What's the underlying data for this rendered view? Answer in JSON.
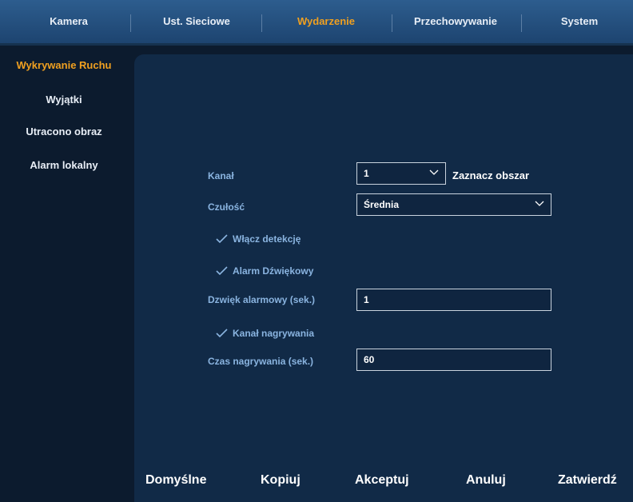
{
  "tabs": [
    {
      "label": "Kamera"
    },
    {
      "label": "Ust. Sieciowe"
    },
    {
      "label": "Wydarzenie"
    },
    {
      "label": "Przechowywanie"
    },
    {
      "label": "System"
    }
  ],
  "active_tab": "Wydarzenie",
  "sidebar": {
    "items": [
      {
        "label": "Wykrywanie Ruchu"
      },
      {
        "label": "Wyjątki"
      },
      {
        "label": "Utracono obraz"
      },
      {
        "label": "Alarm lokalny"
      }
    ]
  },
  "form": {
    "channel_label": "Kanał",
    "channel_value": "1",
    "select_area_label": "Zaznacz obszar",
    "sensitivity_label": "Czułość",
    "sensitivity_value": "Średnia",
    "enable_detection_label": "Włącz detekcję",
    "alarm_sound_label": "Alarm Dźwiękowy",
    "alarm_duration_label": "Dzwięk alarmowy (sek.)",
    "alarm_duration_value": "1",
    "record_channel_label": "Kanał nagrywania",
    "record_time_label": "Czas nagrywania (sek.)",
    "record_time_value": "60"
  },
  "footer": {
    "default_label": "Domyślne",
    "copy_label": "Kopiuj",
    "accept_label": "Akceptuj",
    "cancel_label": "Anuluj",
    "confirm_label": "Zatwierdź"
  },
  "colors": {
    "accent": "#f0a020",
    "label": "#8ab4e0",
    "background": "#0c1b2e",
    "panel": "#112a47"
  }
}
